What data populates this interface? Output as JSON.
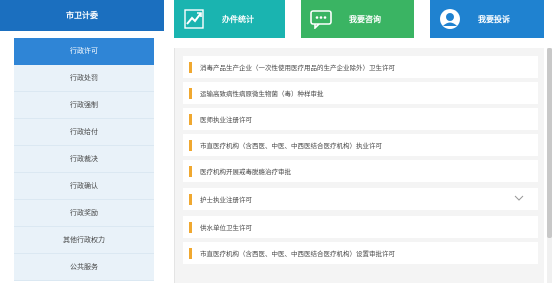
{
  "sidebar": {
    "title": "市卫计委",
    "items": [
      {
        "label": "行政许可",
        "active": true
      },
      {
        "label": "行政处罚"
      },
      {
        "label": "行政强制"
      },
      {
        "label": "行政给付"
      },
      {
        "label": "行政裁决"
      },
      {
        "label": "行政确认"
      },
      {
        "label": "行政奖励"
      },
      {
        "label": "其他行政权力"
      },
      {
        "label": "公共服务"
      }
    ]
  },
  "tiles": [
    {
      "label": "办件统计",
      "icon": "chart-icon",
      "color": "#1ab4b0"
    },
    {
      "label": "我要咨询",
      "icon": "chat-icon",
      "color": "#3ab463"
    },
    {
      "label": "我要投诉",
      "icon": "person-icon",
      "color": "#1f82d0"
    }
  ],
  "list": [
    "消毒产品生产企业（一次性使用医疗用品的生产企业除外）卫生许可",
    "运输高致病性病原微生物菌（毒）种样审批",
    "医师执业注册许可",
    "市直医疗机构（含西医、中医、中西医结合医疗机构）执业许可",
    "医疗机构开展戒毒脱瘾治疗审批",
    "护士执业注册许可",
    "供水单位卫生许可",
    "市直医疗机构（含西医、中医、中西医结合医疗机构）设置审批许可"
  ],
  "colors": {
    "accent_bar": "#f0a830",
    "sidebar_header": "#1b6fbf",
    "sidebar_active": "#2f85d6"
  }
}
